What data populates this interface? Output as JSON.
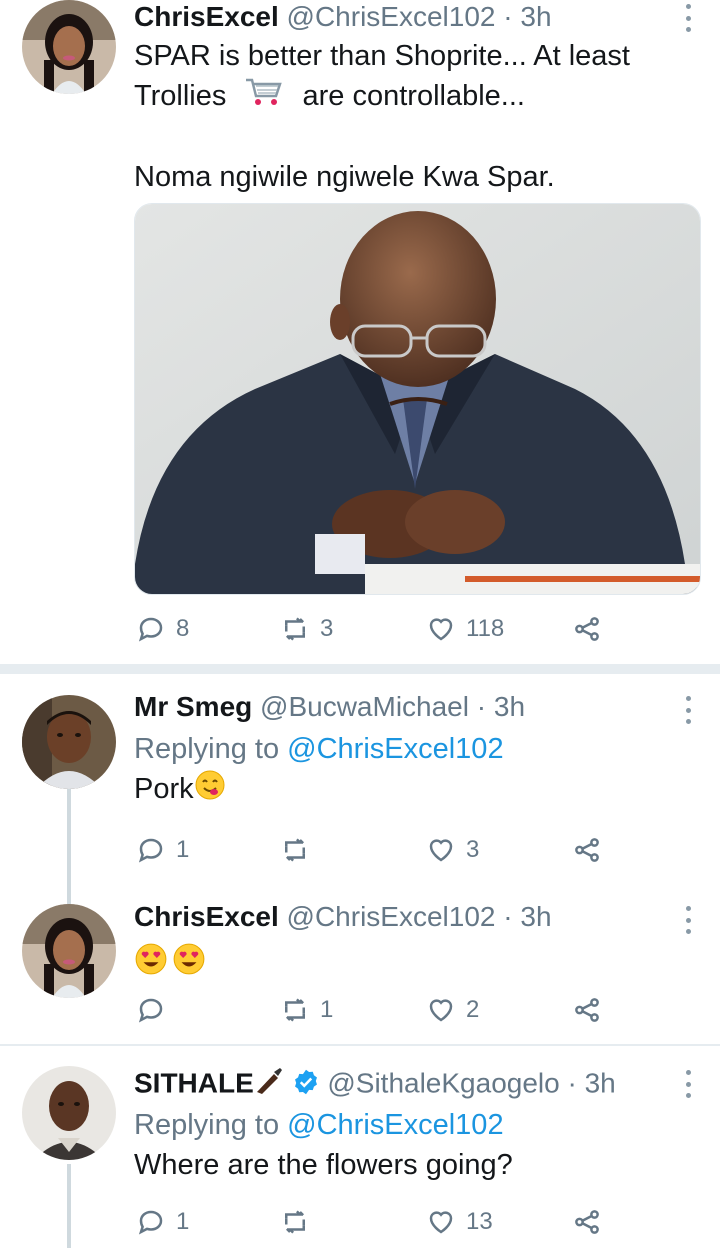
{
  "tweets": [
    {
      "name": "ChrisExcel",
      "handle": "@ChrisExcel102",
      "time": "· 3h",
      "text_line1": "SPAR is better than Shoprite... At least",
      "text_line2a": "Trollies",
      "text_line2b": "are controllable...",
      "text_line3": "Noma ngiwile ngiwele Kwa Spar.",
      "replies": "8",
      "retweets": "3",
      "likes": "118"
    },
    {
      "name": "Mr Smeg",
      "handle": "@BucwaMichael",
      "time": "· 3h",
      "replying_prefix": "Replying to",
      "replying_to": "@ChrisExcel102",
      "text": "Pork",
      "replies": "1",
      "retweets": "",
      "likes": "3"
    },
    {
      "name": "ChrisExcel",
      "handle": "@ChrisExcel102",
      "time": "· 3h",
      "replies": "",
      "retweets": "1",
      "likes": "2"
    },
    {
      "name": "SITHALE",
      "handle": "@SithaleKgaogelo",
      "time": "· 3h",
      "replying_prefix": "Replying to",
      "replying_to": "@ChrisExcel102",
      "text": "Where are the flowers going?",
      "replies": "1",
      "retweets": "",
      "likes": "13"
    }
  ],
  "colors": {
    "text": "#14171a",
    "secondary": "#657786",
    "link": "#1b95e0",
    "divider": "#e6ecf0"
  }
}
